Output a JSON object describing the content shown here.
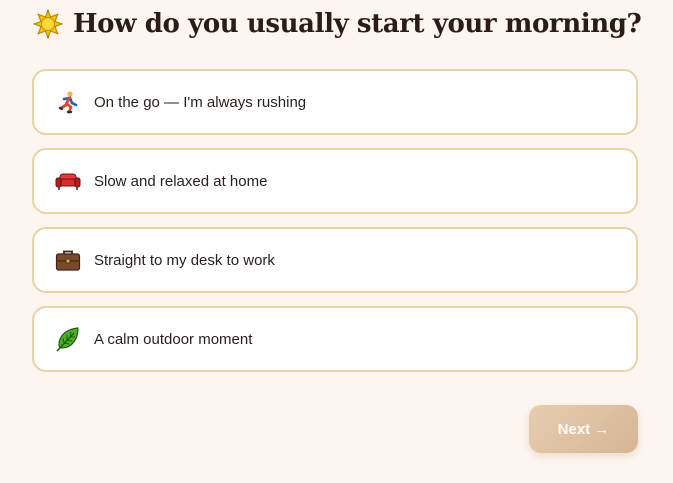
{
  "question": {
    "icon": "sun-icon",
    "text": "How do you usually start your morning?"
  },
  "options": [
    {
      "icon": "running-person-icon",
      "label": "On the go — I'm always rushing"
    },
    {
      "icon": "couch-icon",
      "label": "Slow and relaxed at home"
    },
    {
      "icon": "briefcase-icon",
      "label": "Straight to my desk to work"
    },
    {
      "icon": "leaf-icon",
      "label": "A calm outdoor moment"
    }
  ],
  "next_button": {
    "label": "Next →"
  },
  "colors": {
    "background": "#fdf6f0",
    "option_border": "#e8d3a8",
    "button": "#ddc0a2"
  }
}
